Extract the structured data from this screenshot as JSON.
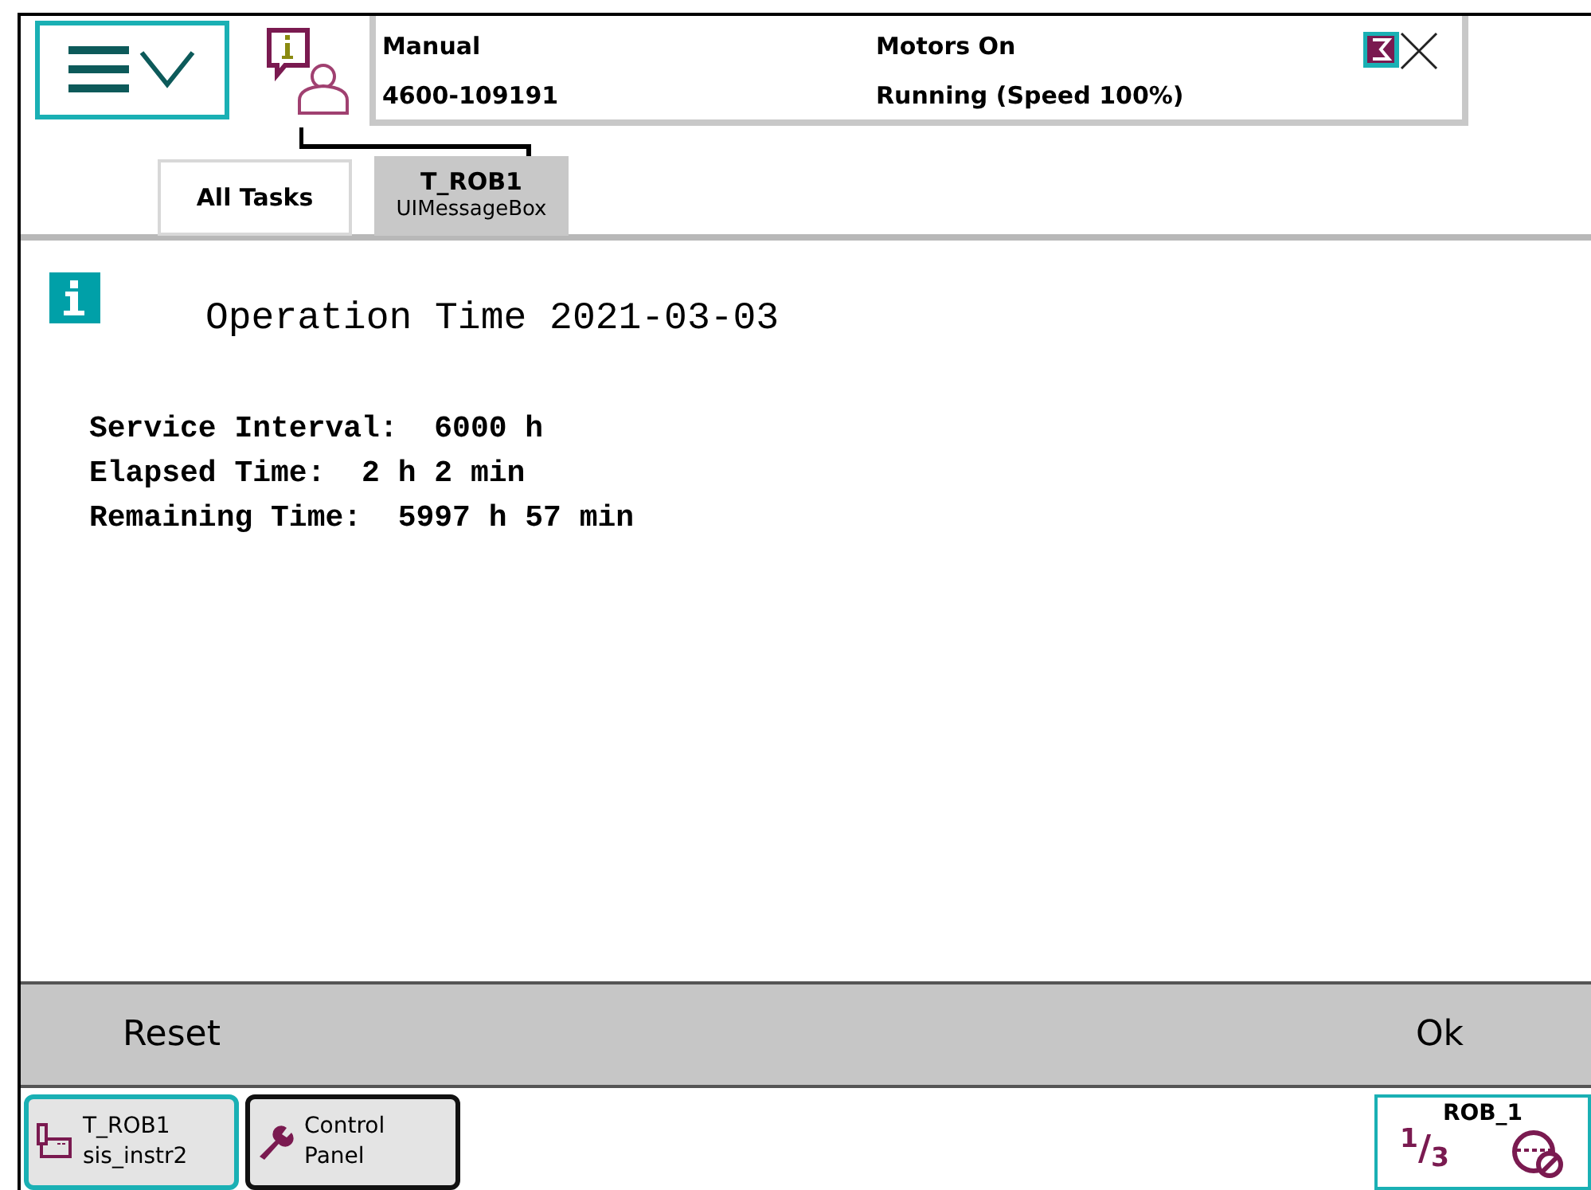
{
  "status": {
    "mode": "Manual",
    "system": "4600-109191",
    "motors": "Motors On",
    "state": "Running (Speed 100%)"
  },
  "tabs": [
    {
      "label": "All Tasks",
      "selected": false
    },
    {
      "label": "T_ROB1",
      "sublabel": "UIMessageBox",
      "selected": true
    }
  ],
  "message": {
    "title": "Operation Time 2021-03-03",
    "lines": [
      "Service Interval:  6000 h",
      "Elapsed Time:  2 h 2 min",
      "Remaining Time:  5997 h 57 min"
    ]
  },
  "buttons": [
    "Reset",
    "Ok"
  ],
  "taskbar": [
    {
      "kind": "program",
      "label": "T_ROB1",
      "sublabel": "sis_instr2",
      "selected": true
    },
    {
      "kind": "panel",
      "label": "Control",
      "sublabel": "Panel",
      "selected": false
    }
  ],
  "quickset": {
    "label": "ROB_1",
    "increment": "$^{1}$/$_{3}$"
  }
}
